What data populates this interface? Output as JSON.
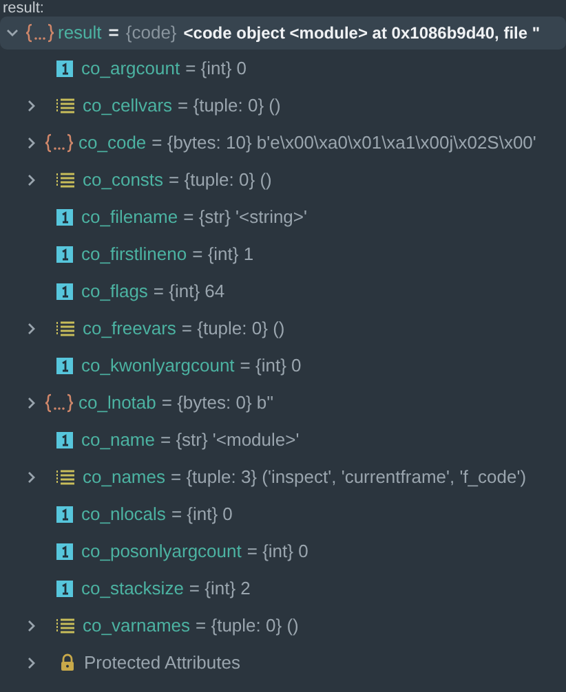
{
  "header": "result:",
  "root": {
    "kind": "object",
    "name": "result",
    "separator": "=",
    "type": "{code}",
    "value": "<code object <module> at 0x1086b9d40, file \"",
    "expanded": true,
    "selected": true
  },
  "rows": [
    {
      "kind": "scalar",
      "name": "co_argcount",
      "value": "= {int} 0",
      "selected": false
    },
    {
      "kind": "sequence",
      "name": "co_cellvars",
      "value": "= {tuple: 0} ()",
      "expanded": false,
      "selected": false
    },
    {
      "kind": "object",
      "name": "co_code",
      "value": "= {bytes: 10} b'e\\x00\\xa0\\x01\\xa1\\x00j\\x02S\\x00'",
      "expanded": false,
      "selected": false
    },
    {
      "kind": "sequence",
      "name": "co_consts",
      "value": "= {tuple: 0} ()",
      "expanded": false,
      "selected": false
    },
    {
      "kind": "scalar",
      "name": "co_filename",
      "value": "= {str} '<string>'",
      "selected": false
    },
    {
      "kind": "scalar",
      "name": "co_firstlineno",
      "value": "= {int} 1",
      "selected": false
    },
    {
      "kind": "scalar",
      "name": "co_flags",
      "value": "= {int} 64",
      "selected": false
    },
    {
      "kind": "sequence",
      "name": "co_freevars",
      "value": "= {tuple: 0} ()",
      "expanded": false,
      "selected": false
    },
    {
      "kind": "scalar",
      "name": "co_kwonlyargcount",
      "value": "= {int} 0",
      "selected": false
    },
    {
      "kind": "object",
      "name": "co_lnotab",
      "value": "= {bytes: 0} b''",
      "expanded": false,
      "selected": false
    },
    {
      "kind": "scalar",
      "name": "co_name",
      "value": "= {str} '<module>'",
      "selected": false
    },
    {
      "kind": "sequence",
      "name": "co_names",
      "value": "= {tuple: 3} ('inspect', 'currentframe', 'f_code')",
      "expanded": false,
      "selected": false
    },
    {
      "kind": "scalar",
      "name": "co_nlocals",
      "value": "= {int} 0",
      "selected": false
    },
    {
      "kind": "scalar",
      "name": "co_posonlyargcount",
      "value": "= {int} 0",
      "selected": false
    },
    {
      "kind": "scalar",
      "name": "co_stacksize",
      "value": "= {int} 2",
      "selected": false
    },
    {
      "kind": "sequence",
      "name": "co_varnames",
      "value": "= {tuple: 0} ()",
      "expanded": false,
      "selected": false
    },
    {
      "kind": "group",
      "name": "Protected Attributes",
      "expanded": false,
      "selected": false
    }
  ]
}
